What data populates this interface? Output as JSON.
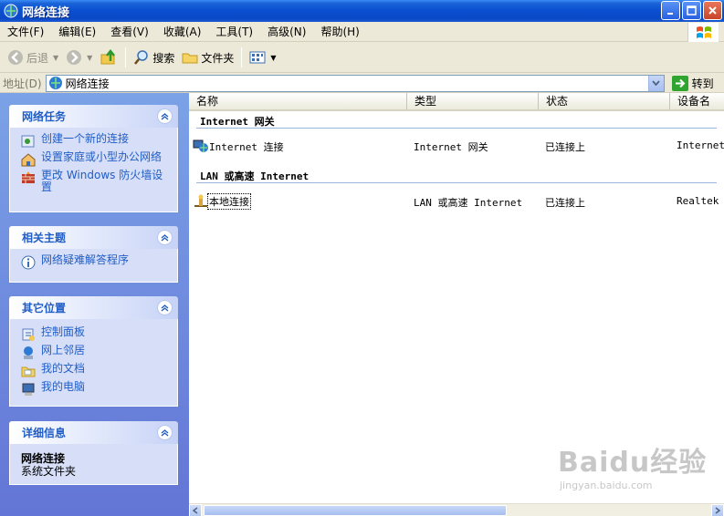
{
  "window": {
    "title": "网络连接"
  },
  "menu": [
    "文件(F)",
    "编辑(E)",
    "查看(V)",
    "收藏(A)",
    "工具(T)",
    "高级(N)",
    "帮助(H)"
  ],
  "toolbar": {
    "back": "后退",
    "search": "搜索",
    "folders": "文件夹"
  },
  "address": {
    "label": "地址(D)",
    "value": "网络连接",
    "goto": "转到"
  },
  "panels": {
    "network_tasks": {
      "title": "网络任务",
      "items": [
        "创建一个新的连接",
        "设置家庭或小型办公网络",
        "更改 Windows 防火墙设置"
      ]
    },
    "related": {
      "title": "相关主题",
      "items": [
        "网络疑难解答程序"
      ]
    },
    "other_places": {
      "title": "其它位置",
      "items": [
        "控制面板",
        "网上邻居",
        "我的文档",
        "我的电脑"
      ]
    },
    "details": {
      "title": "详细信息",
      "name": "网络连接",
      "type": "系统文件夹"
    }
  },
  "columns": [
    "名称",
    "类型",
    "状态",
    "设备名"
  ],
  "groups": [
    {
      "title": "Internet 网关",
      "row": {
        "name": "Internet 连接",
        "type": "Internet 网关",
        "status": "已连接上",
        "device": "Internet"
      }
    },
    {
      "title": "LAN 或高速 Internet",
      "row": {
        "name": "本地连接",
        "type": "LAN 或高速 Internet",
        "status": "已连接上",
        "device": "Realtek"
      }
    }
  ],
  "watermark": {
    "brand": "Baidu经验",
    "site": "jingyan.baidu.com"
  },
  "colors": {
    "titlebar": "#0a4fd0",
    "taskpane": "#7ba2e7",
    "link": "#215dc6"
  }
}
